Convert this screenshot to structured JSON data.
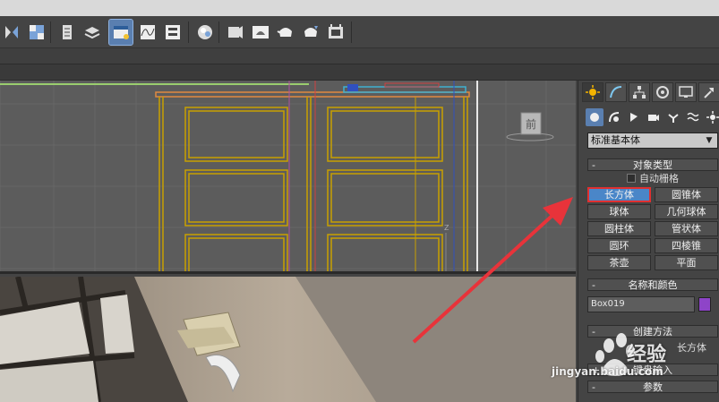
{
  "toolbar": {
    "icons": [
      "mirror-icon",
      "align-icon",
      "layer-manager-icon",
      "scene-explorer-icon",
      "ribbon-icon",
      "curve-editor-icon",
      "schematic-view-icon",
      "material-editor-icon",
      "render-setup-icon",
      "render-frame-icon",
      "quick-render-icon",
      "render-iterative-icon",
      "activeshade-icon"
    ]
  },
  "command_panel": {
    "tabs": [
      "create-tab",
      "modify-tab",
      "hierarchy-tab",
      "motion-tab",
      "display-tab",
      "utilities-tab"
    ],
    "subtabs": [
      "geometry-icon",
      "shapes-icon",
      "lights-icon",
      "cameras-icon",
      "helpers-icon",
      "space-warps-icon",
      "systems-icon"
    ],
    "category_dropdown": "标准基本体",
    "object_type": {
      "header": "对象类型",
      "sign": "-",
      "auto_grid": "自动栅格",
      "buttons": [
        "长方体",
        "圆锥体",
        "球体",
        "几何球体",
        "圆柱体",
        "管状体",
        "圆环",
        "四棱锥",
        "茶壶",
        "平面"
      ],
      "active_button": "长方体"
    },
    "name_color": {
      "header": "名称和颜色",
      "sign": "-",
      "name_value": "Box019",
      "color": "#8e44c8"
    },
    "creation_method": {
      "header": "创建方法",
      "sign": "-",
      "option_label": "长方体"
    },
    "keyboard_entry": {
      "header": "键盘输入",
      "sign": "+"
    },
    "parameters": {
      "header": "参数",
      "sign": "-"
    }
  },
  "viewport": {
    "viewcube_label": "前",
    "axis_label": "Z"
  },
  "watermark": {
    "brand_text": "经验",
    "url": "jingyan.baidu.com"
  },
  "colors": {
    "selection_blue": "#4a86c8",
    "highlight_red": "#e03030",
    "wireframe_gold": "#c8a000",
    "annotation_arrow": "#e8333a"
  }
}
